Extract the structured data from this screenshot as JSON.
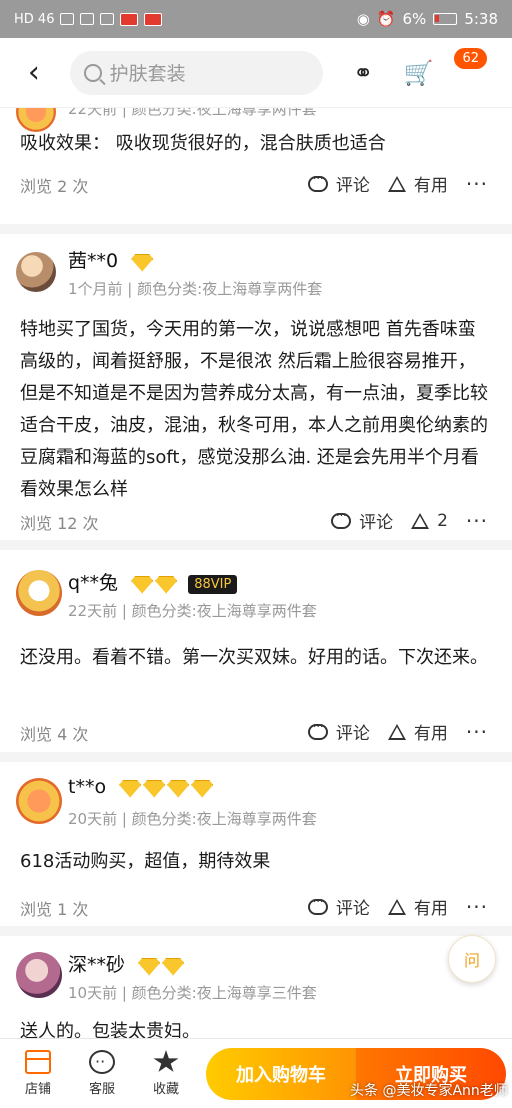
{
  "status_bar": {
    "left_text": "HD 46",
    "battery": "6%",
    "time": "5:38"
  },
  "nav": {
    "back_icon": "chevron-left-icon",
    "search_placeholder": "护肤套装",
    "cart_badge": "62"
  },
  "reviews": [
    {
      "meta": "22天前 | 颜色分类:夜上海尊享两件套",
      "text": "吸收效果：  吸收现货很好的，混合肤质也适合",
      "views": "浏览 2 次",
      "comment_label": "评论",
      "useful_label": "有用"
    },
    {
      "user": "茜**0",
      "meta": "1个月前 | 颜色分类:夜上海尊享两件套",
      "text": "特地买了国货，今天用的第一次，说说感想吧 首先香味蛮高级的，闻着挺舒服，不是很浓 然后霜上脸很容易推开，但是不知道是不是因为营养成分太高，有一点油，夏季比较适合干皮，油皮，混油，秋冬可用，本人之前用奥伦纳素的豆腐霜和海蓝的soft，感觉没那么油. 还是会先用半个月看看效果怎么样",
      "views": "浏览 12 次",
      "comment_label": "评论",
      "useful_label": "2"
    },
    {
      "user": "q**兔",
      "vip": "88VIP",
      "meta": "22天前 | 颜色分类:夜上海尊享两件套",
      "text": "还没用。看着不错。第一次买双妹。好用的话。下次还来。",
      "views": "浏览 4 次",
      "comment_label": "评论",
      "useful_label": "有用"
    },
    {
      "user": "t**o",
      "meta": "20天前 | 颜色分类:夜上海尊享两件套",
      "text": "618活动购买，超值，期待效果",
      "views": "浏览 1 次",
      "comment_label": "评论",
      "useful_label": "有用"
    },
    {
      "user": "深**砂",
      "meta": "10天前 | 颜色分类:夜上海尊享三件套",
      "text": "送人的。包装太贵妇。"
    }
  ],
  "fab_label": "问",
  "bottom": {
    "store_label": "店铺",
    "service_label": "客服",
    "fav_label": "收藏",
    "add_cart_label": "加入购物车",
    "buy_label": "立即购买"
  },
  "watermark": "头条 @美妆专家Ann老师"
}
